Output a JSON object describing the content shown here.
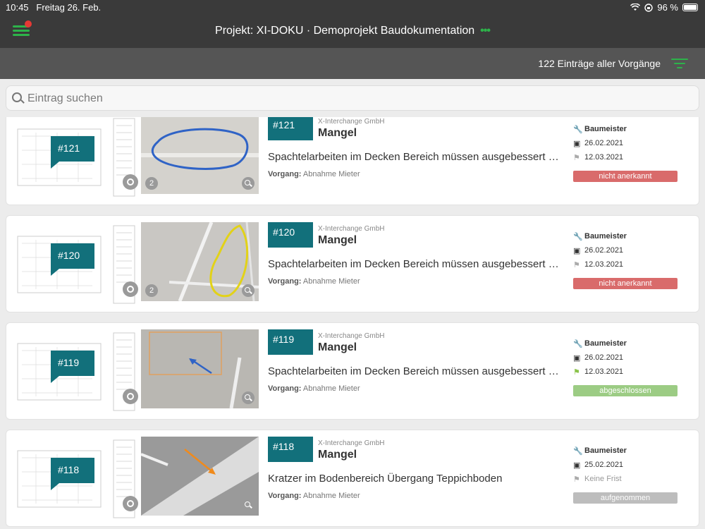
{
  "statusbar": {
    "time": "10:45",
    "date": "Freitag 26. Feb.",
    "battery": "96 %"
  },
  "header": {
    "title": "Projekt: XI-DOKU · Demoprojekt Baudokumentation",
    "dots": "•••"
  },
  "subbar": {
    "count": "122 Einträge aller Vorgänge"
  },
  "search": {
    "placeholder": "Eintrag suchen"
  },
  "labels": {
    "vorgang_prefix": "Vorgang:"
  },
  "colors": {
    "accent": "#2db34a",
    "teal": "#12707b",
    "not_accepted": "#d96b6b",
    "done": "#9ccc84",
    "open": "#bdbdbd"
  },
  "entries": [
    {
      "id": "#121",
      "company": "X-Interchange GmbH",
      "type": "Mangel",
      "description": "Spachtelarbeiten im Decken Bereich müssen ausgebessert werden",
      "vorgang": "Abnahme Mieter",
      "role": "Baumeister",
      "date": "26.02.2021",
      "deadline": "12.03.2021",
      "status": "nicht anerkannt",
      "photo_count": "2"
    },
    {
      "id": "#120",
      "company": "X-Interchange GmbH",
      "type": "Mangel",
      "description": "Spachtelarbeiten im Decken Bereich müssen ausgebessert werden",
      "vorgang": "Abnahme Mieter",
      "role": "Baumeister",
      "date": "26.02.2021",
      "deadline": "12.03.2021",
      "status": "nicht anerkannt",
      "photo_count": "2"
    },
    {
      "id": "#119",
      "company": "X-Interchange GmbH",
      "type": "Mangel",
      "description": "Spachtelarbeiten im Decken Bereich müssen ausgebessert werden",
      "vorgang": "Abnahme Mieter",
      "role": "Baumeister",
      "date": "26.02.2021",
      "deadline": "12.03.2021",
      "status": "abgeschlossen",
      "photo_count": ""
    },
    {
      "id": "#118",
      "company": "X-Interchange GmbH",
      "type": "Mangel",
      "description": "Kratzer im Bodenbereich Übergang Teppichboden",
      "vorgang": "Abnahme Mieter",
      "role": "Baumeister",
      "date": "25.02.2021",
      "deadline": "Keine Frist",
      "status": "aufgenommen",
      "photo_count": ""
    }
  ]
}
